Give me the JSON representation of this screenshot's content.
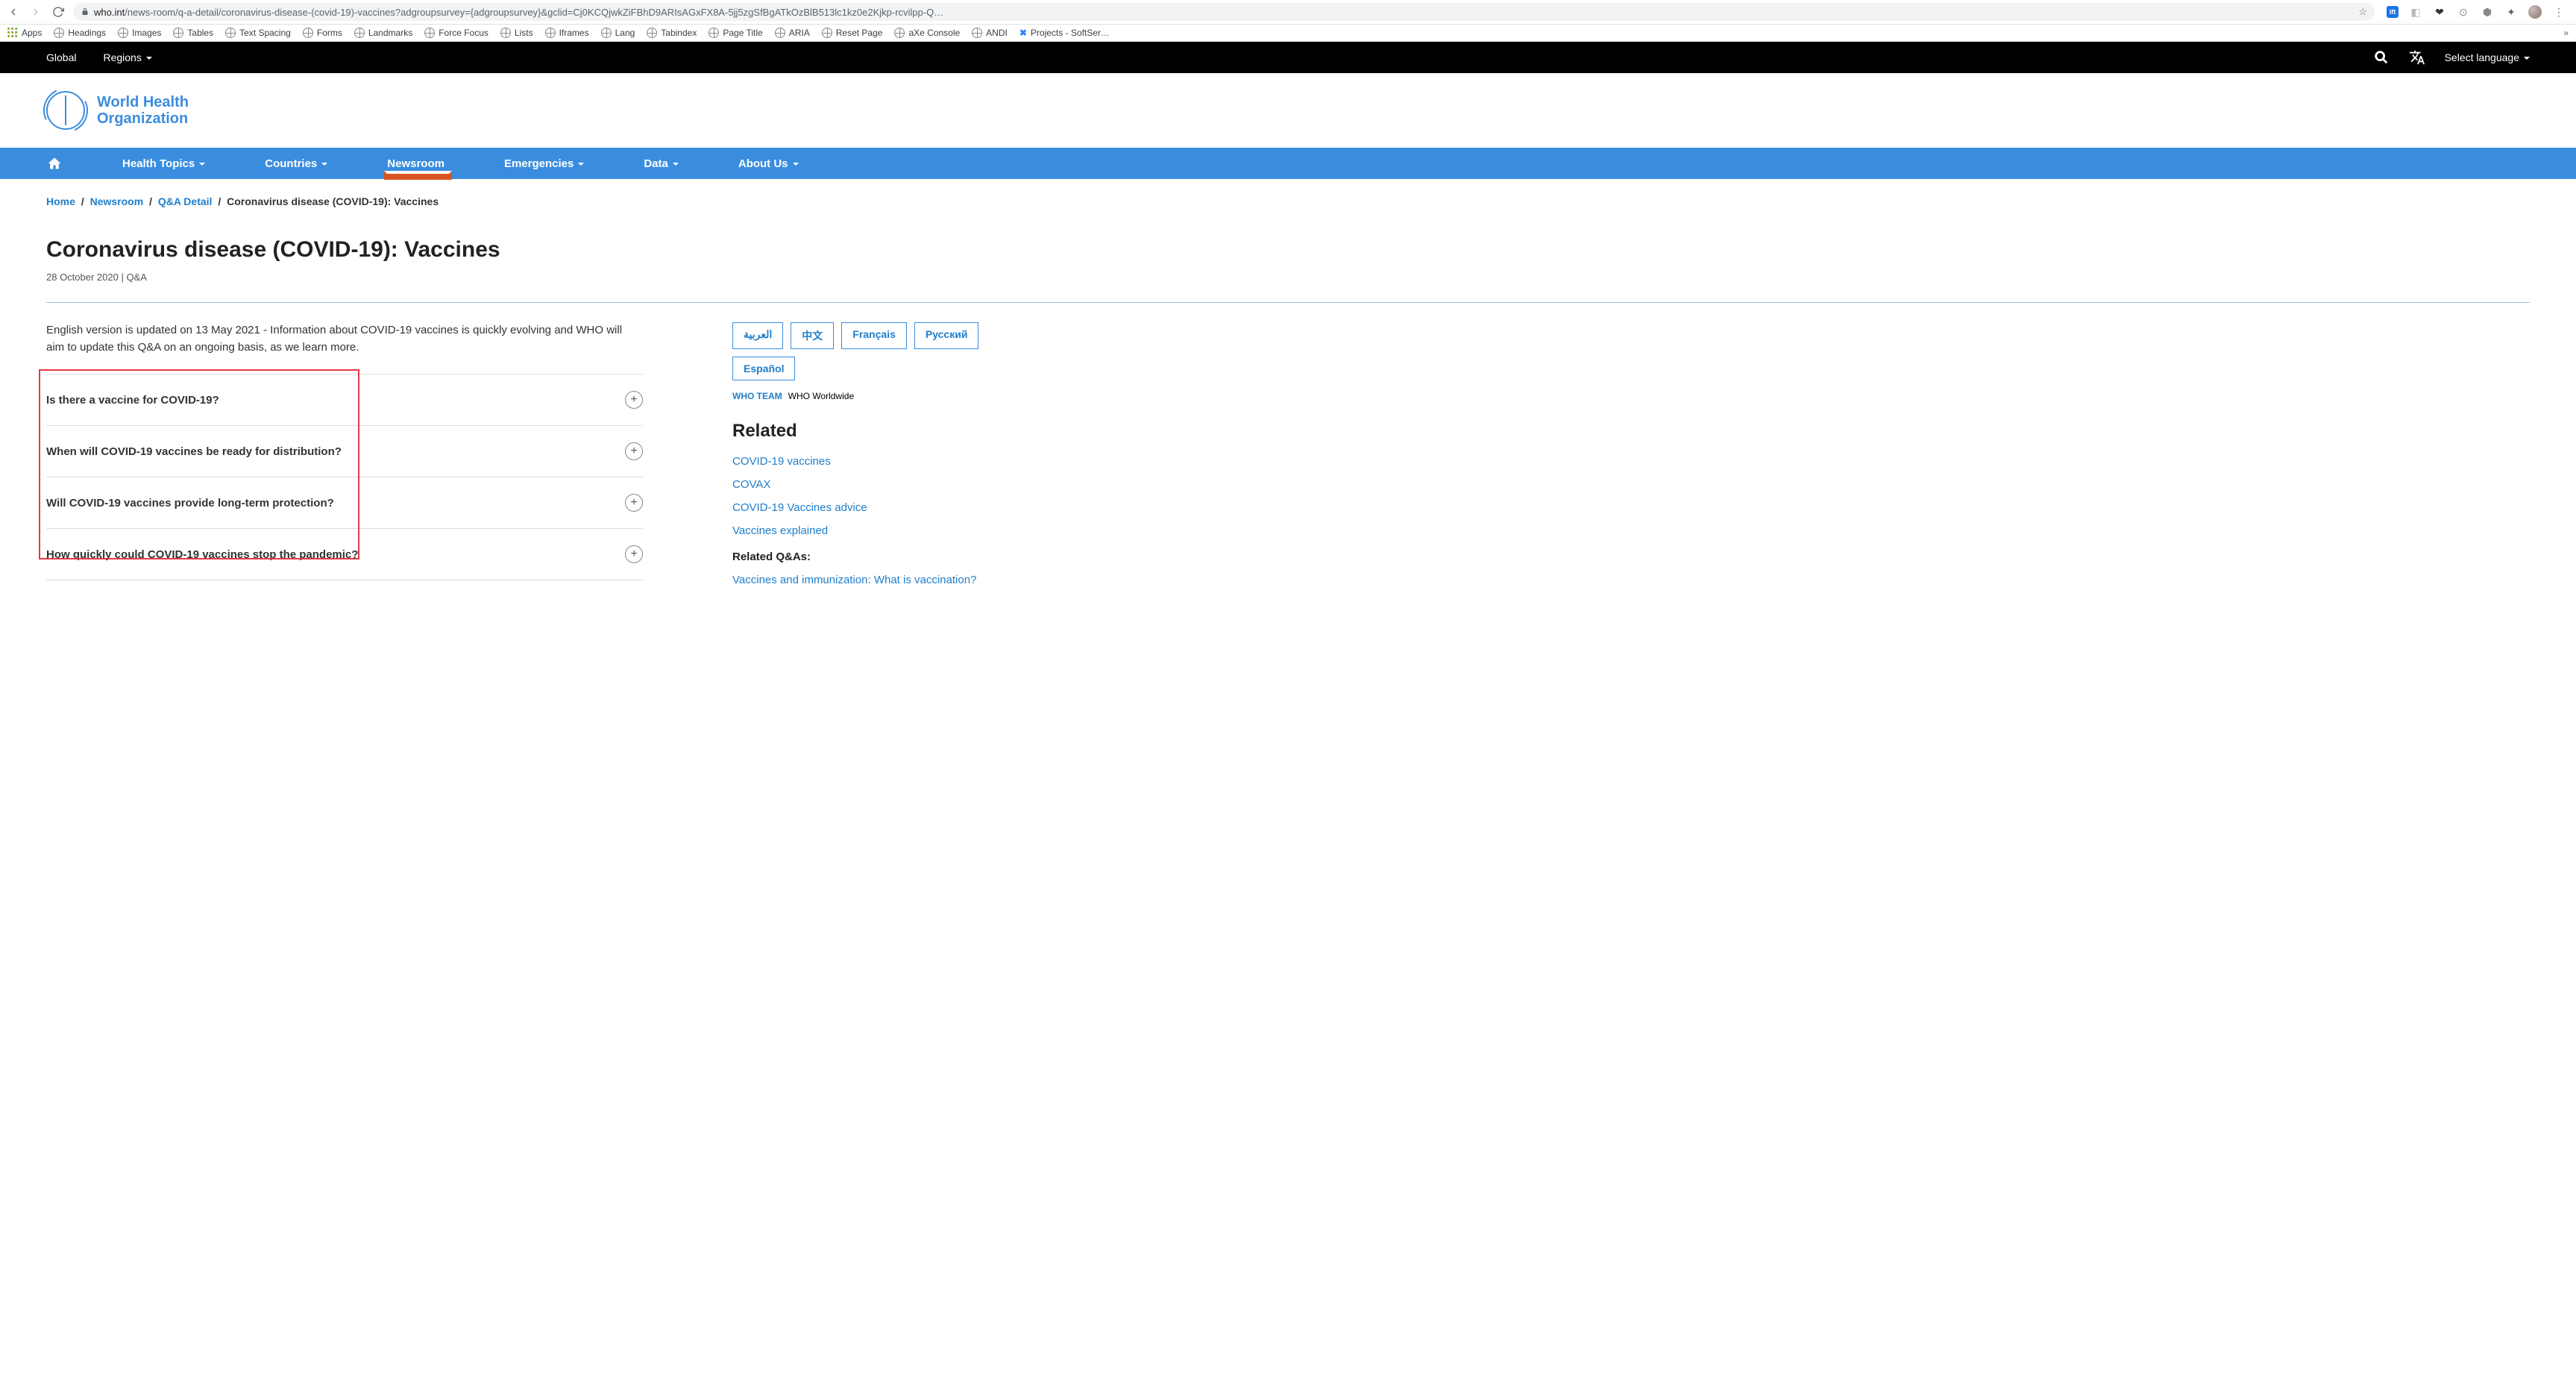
{
  "browser": {
    "url_host": "who.int",
    "url_path": "/news-room/q-a-detail/coronavirus-disease-(covid-19)-vaccines?adgroupsurvey={adgroupsurvey}&gclid=Cj0KCQjwkZiFBhD9ARIsAGxFX8A-5jj5zgSfBgATkOzBlB513lc1kz0e2Kjkp-rcvilpp-Q…"
  },
  "bookmarks": [
    "Apps",
    "Headings",
    "Images",
    "Tables",
    "Text Spacing",
    "Forms",
    "Landmarks",
    "Force Focus",
    "Lists",
    "Iframes",
    "Lang",
    "Tabindex",
    "Page Title",
    "ARIA",
    "Reset Page",
    "aXe Console",
    "ANDI",
    "Projects - SoftSer…"
  ],
  "topbar": {
    "global": "Global",
    "regions": "Regions",
    "select_language": "Select language"
  },
  "logo": {
    "line1": "World Health",
    "line2": "Organization"
  },
  "nav": [
    "Health Topics",
    "Countries",
    "Newsroom",
    "Emergencies",
    "Data",
    "About Us"
  ],
  "breadcrumb": {
    "home": "Home",
    "newsroom": "Newsroom",
    "qadetail": "Q&A Detail",
    "current": "Coronavirus disease (COVID-19): Vaccines"
  },
  "page": {
    "title": "Coronavirus disease (COVID-19): Vaccines",
    "meta": "28 October 2020 | Q&A",
    "intro": "English version is updated on 13 May 2021 - Information about COVID-19 vaccines is quickly evolving and WHO will aim to update this Q&A on an ongoing basis, as we learn more."
  },
  "questions": [
    "Is there a vaccine for COVID-19?",
    "When will COVID-19 vaccines be ready for distribution?",
    "Will COVID-19 vaccines provide long-term protection?",
    "How quickly could COVID-19 vaccines stop the pandemic?"
  ],
  "sidebar": {
    "langs": [
      "العربية",
      "中文",
      "Français",
      "Русский",
      "Español"
    ],
    "team_label": "WHO TEAM",
    "team_value": "WHO Worldwide",
    "related_h": "Related",
    "related_links": [
      "COVID-19 vaccines",
      "COVAX",
      "COVID-19 Vaccines advice",
      "Vaccines explained"
    ],
    "related_qas_h": "Related Q&As:",
    "related_qas": [
      "Vaccines and immunization: What is vaccination?"
    ]
  }
}
